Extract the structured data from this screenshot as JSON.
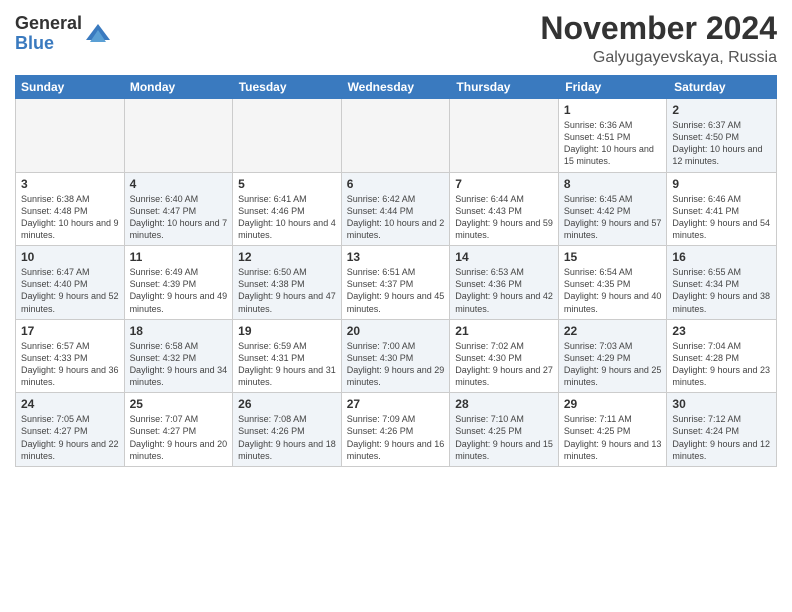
{
  "logo": {
    "general": "General",
    "blue": "Blue"
  },
  "title": "November 2024",
  "location": "Galyugayevskaya, Russia",
  "header_days": [
    "Sunday",
    "Monday",
    "Tuesday",
    "Wednesday",
    "Thursday",
    "Friday",
    "Saturday"
  ],
  "rows": [
    [
      {
        "day": "",
        "info": "",
        "empty": true
      },
      {
        "day": "",
        "info": "",
        "empty": true
      },
      {
        "day": "",
        "info": "",
        "empty": true
      },
      {
        "day": "",
        "info": "",
        "empty": true
      },
      {
        "day": "",
        "info": "",
        "empty": true
      },
      {
        "day": "1",
        "info": "Sunrise: 6:36 AM\nSunset: 4:51 PM\nDaylight: 10 hours and 15 minutes.",
        "empty": false
      },
      {
        "day": "2",
        "info": "Sunrise: 6:37 AM\nSunset: 4:50 PM\nDaylight: 10 hours and 12 minutes.",
        "empty": false,
        "shaded": true
      }
    ],
    [
      {
        "day": "3",
        "info": "Sunrise: 6:38 AM\nSunset: 4:48 PM\nDaylight: 10 hours and 9 minutes.",
        "empty": false
      },
      {
        "day": "4",
        "info": "Sunrise: 6:40 AM\nSunset: 4:47 PM\nDaylight: 10 hours and 7 minutes.",
        "empty": false,
        "shaded": true
      },
      {
        "day": "5",
        "info": "Sunrise: 6:41 AM\nSunset: 4:46 PM\nDaylight: 10 hours and 4 minutes.",
        "empty": false
      },
      {
        "day": "6",
        "info": "Sunrise: 6:42 AM\nSunset: 4:44 PM\nDaylight: 10 hours and 2 minutes.",
        "empty": false,
        "shaded": true
      },
      {
        "day": "7",
        "info": "Sunrise: 6:44 AM\nSunset: 4:43 PM\nDaylight: 9 hours and 59 minutes.",
        "empty": false
      },
      {
        "day": "8",
        "info": "Sunrise: 6:45 AM\nSunset: 4:42 PM\nDaylight: 9 hours and 57 minutes.",
        "empty": false,
        "shaded": true
      },
      {
        "day": "9",
        "info": "Sunrise: 6:46 AM\nSunset: 4:41 PM\nDaylight: 9 hours and 54 minutes.",
        "empty": false
      }
    ],
    [
      {
        "day": "10",
        "info": "Sunrise: 6:47 AM\nSunset: 4:40 PM\nDaylight: 9 hours and 52 minutes.",
        "empty": false,
        "shaded": true
      },
      {
        "day": "11",
        "info": "Sunrise: 6:49 AM\nSunset: 4:39 PM\nDaylight: 9 hours and 49 minutes.",
        "empty": false
      },
      {
        "day": "12",
        "info": "Sunrise: 6:50 AM\nSunset: 4:38 PM\nDaylight: 9 hours and 47 minutes.",
        "empty": false,
        "shaded": true
      },
      {
        "day": "13",
        "info": "Sunrise: 6:51 AM\nSunset: 4:37 PM\nDaylight: 9 hours and 45 minutes.",
        "empty": false
      },
      {
        "day": "14",
        "info": "Sunrise: 6:53 AM\nSunset: 4:36 PM\nDaylight: 9 hours and 42 minutes.",
        "empty": false,
        "shaded": true
      },
      {
        "day": "15",
        "info": "Sunrise: 6:54 AM\nSunset: 4:35 PM\nDaylight: 9 hours and 40 minutes.",
        "empty": false
      },
      {
        "day": "16",
        "info": "Sunrise: 6:55 AM\nSunset: 4:34 PM\nDaylight: 9 hours and 38 minutes.",
        "empty": false,
        "shaded": true
      }
    ],
    [
      {
        "day": "17",
        "info": "Sunrise: 6:57 AM\nSunset: 4:33 PM\nDaylight: 9 hours and 36 minutes.",
        "empty": false
      },
      {
        "day": "18",
        "info": "Sunrise: 6:58 AM\nSunset: 4:32 PM\nDaylight: 9 hours and 34 minutes.",
        "empty": false,
        "shaded": true
      },
      {
        "day": "19",
        "info": "Sunrise: 6:59 AM\nSunset: 4:31 PM\nDaylight: 9 hours and 31 minutes.",
        "empty": false
      },
      {
        "day": "20",
        "info": "Sunrise: 7:00 AM\nSunset: 4:30 PM\nDaylight: 9 hours and 29 minutes.",
        "empty": false,
        "shaded": true
      },
      {
        "day": "21",
        "info": "Sunrise: 7:02 AM\nSunset: 4:30 PM\nDaylight: 9 hours and 27 minutes.",
        "empty": false
      },
      {
        "day": "22",
        "info": "Sunrise: 7:03 AM\nSunset: 4:29 PM\nDaylight: 9 hours and 25 minutes.",
        "empty": false,
        "shaded": true
      },
      {
        "day": "23",
        "info": "Sunrise: 7:04 AM\nSunset: 4:28 PM\nDaylight: 9 hours and 23 minutes.",
        "empty": false
      }
    ],
    [
      {
        "day": "24",
        "info": "Sunrise: 7:05 AM\nSunset: 4:27 PM\nDaylight: 9 hours and 22 minutes.",
        "empty": false,
        "shaded": true
      },
      {
        "day": "25",
        "info": "Sunrise: 7:07 AM\nSunset: 4:27 PM\nDaylight: 9 hours and 20 minutes.",
        "empty": false
      },
      {
        "day": "26",
        "info": "Sunrise: 7:08 AM\nSunset: 4:26 PM\nDaylight: 9 hours and 18 minutes.",
        "empty": false,
        "shaded": true
      },
      {
        "day": "27",
        "info": "Sunrise: 7:09 AM\nSunset: 4:26 PM\nDaylight: 9 hours and 16 minutes.",
        "empty": false
      },
      {
        "day": "28",
        "info": "Sunrise: 7:10 AM\nSunset: 4:25 PM\nDaylight: 9 hours and 15 minutes.",
        "empty": false,
        "shaded": true
      },
      {
        "day": "29",
        "info": "Sunrise: 7:11 AM\nSunset: 4:25 PM\nDaylight: 9 hours and 13 minutes.",
        "empty": false
      },
      {
        "day": "30",
        "info": "Sunrise: 7:12 AM\nSunset: 4:24 PM\nDaylight: 9 hours and 12 minutes.",
        "empty": false,
        "shaded": true
      }
    ]
  ]
}
